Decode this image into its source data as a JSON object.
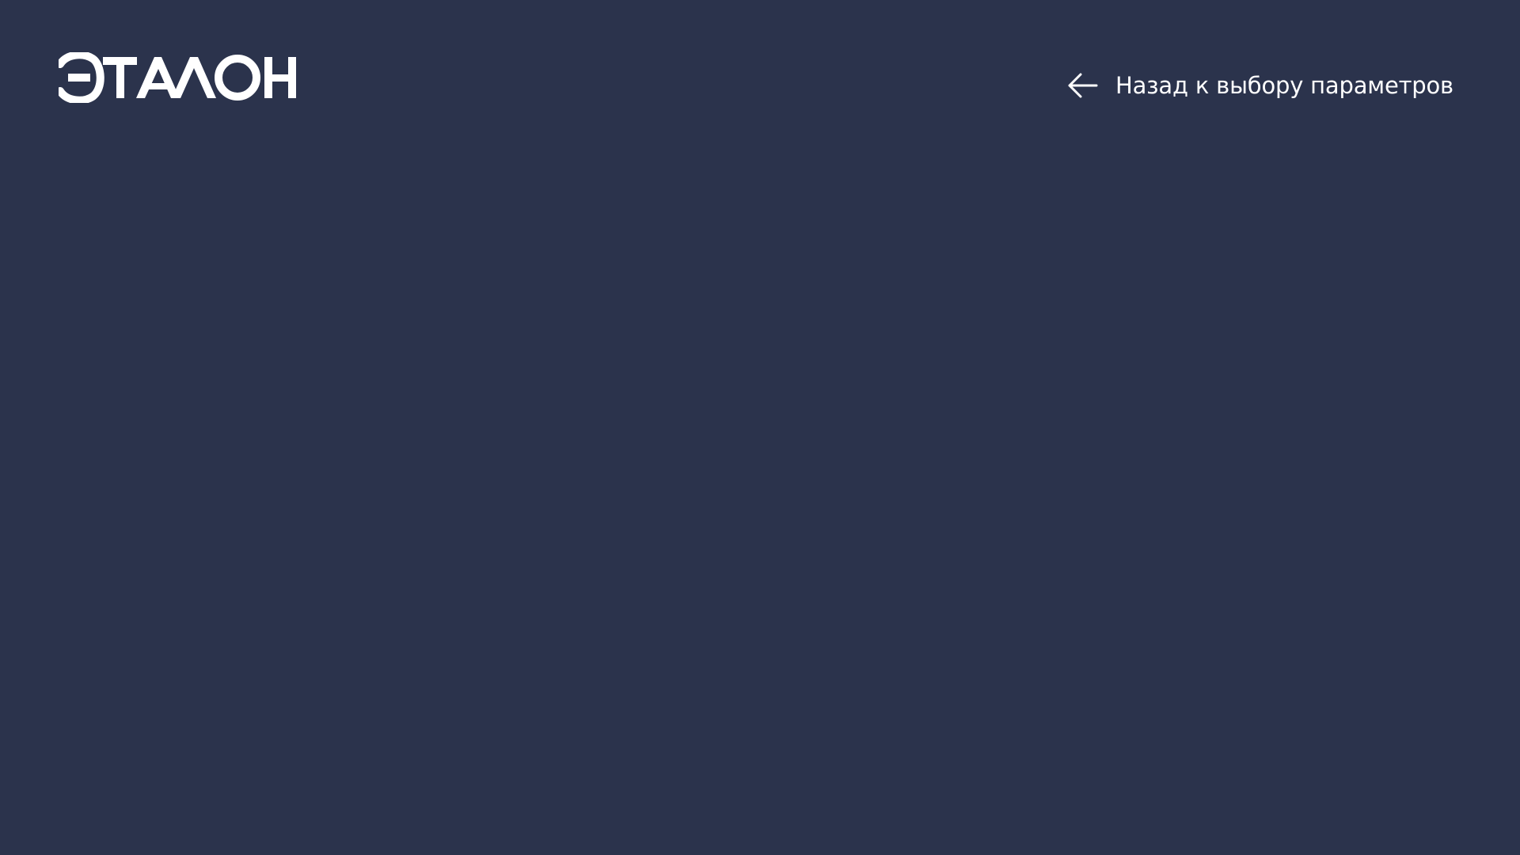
{
  "app": {
    "background_color": "#2b334c",
    "foreground_color": "#ffffff"
  },
  "header": {
    "logo": {
      "text": "ЭТАЛОН",
      "icon_name": "brand-wordmark-logo"
    },
    "back_link": {
      "label": "Назад к выбору параметров",
      "icon_name": "arrow-left-icon"
    }
  },
  "main": {}
}
